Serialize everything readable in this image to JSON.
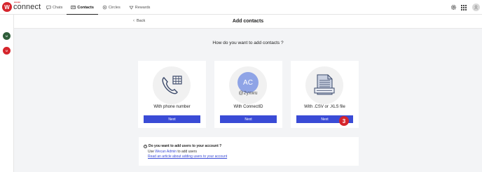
{
  "app": {
    "logo_badge": "W",
    "logo_brand": "wecan",
    "logo_word": "connect",
    "accent": "#3a4bd6",
    "brand": "#d5252c"
  },
  "nav": {
    "items": [
      {
        "label": "Chats",
        "icon": "chat-icon"
      },
      {
        "label": "Contacts",
        "icon": "contacts-icon",
        "active": true
      },
      {
        "label": "Circles",
        "icon": "circles-icon"
      },
      {
        "label": "Rewards",
        "icon": "rewards-icon"
      }
    ],
    "right_icons": [
      "gear-icon",
      "apps-grid-icon",
      "user-avatar-icon"
    ]
  },
  "rail": {
    "items": [
      {
        "initial": "M",
        "color": "#2f5d3a"
      },
      {
        "initial": "M",
        "color": "#d5252c"
      }
    ]
  },
  "subheader": {
    "back_label": "Back",
    "title": "Add contacts"
  },
  "main": {
    "question": "How do you want to add contacts ?",
    "cards": [
      {
        "label": "With phone number",
        "button": "Next",
        "icon": "phone-book-icon"
      },
      {
        "label": "With ConnectID",
        "button": "Next",
        "icon": "connectid-avatar",
        "avatar_initials": "AC",
        "handle": "@2yxwu"
      },
      {
        "label": "With .CSV or .XLS file",
        "button": "Next",
        "icon": "spreadsheet-file-icon"
      }
    ],
    "step_badge": "3"
  },
  "info": {
    "title": "Do you want to add users to your account ?",
    "line_prefix": "Use ",
    "line_link": "Wecan Admin",
    "line_suffix": " to add users",
    "article_link": "Read an article about adding users to your account"
  }
}
